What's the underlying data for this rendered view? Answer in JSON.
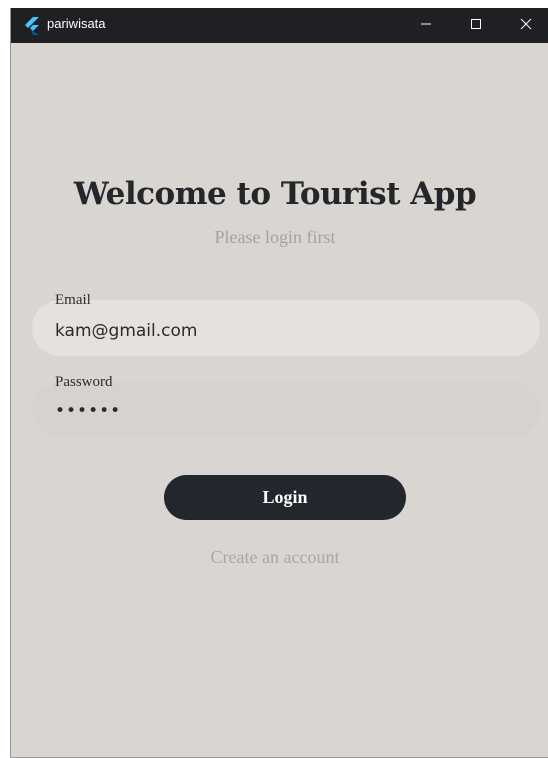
{
  "window": {
    "title": "pariwisata",
    "app_icon": "flutter-logo-icon",
    "controls": {
      "minimize_icon": "minimize-icon",
      "maximize_icon": "maximize-icon",
      "close_icon": "close-icon"
    }
  },
  "login": {
    "heading": "Welcome to Tourist App",
    "subheading": "Please login first",
    "email": {
      "label": "Email",
      "value": "kam@gmail.com"
    },
    "password": {
      "label": "Password",
      "value": "••••••"
    },
    "login_button": "Login",
    "create_account_link": "Create an account"
  },
  "colors": {
    "background": "#d9d6d2",
    "titlebar": "#1f2023",
    "primary_button": "#23262d",
    "muted_text": "#a4a29f"
  }
}
